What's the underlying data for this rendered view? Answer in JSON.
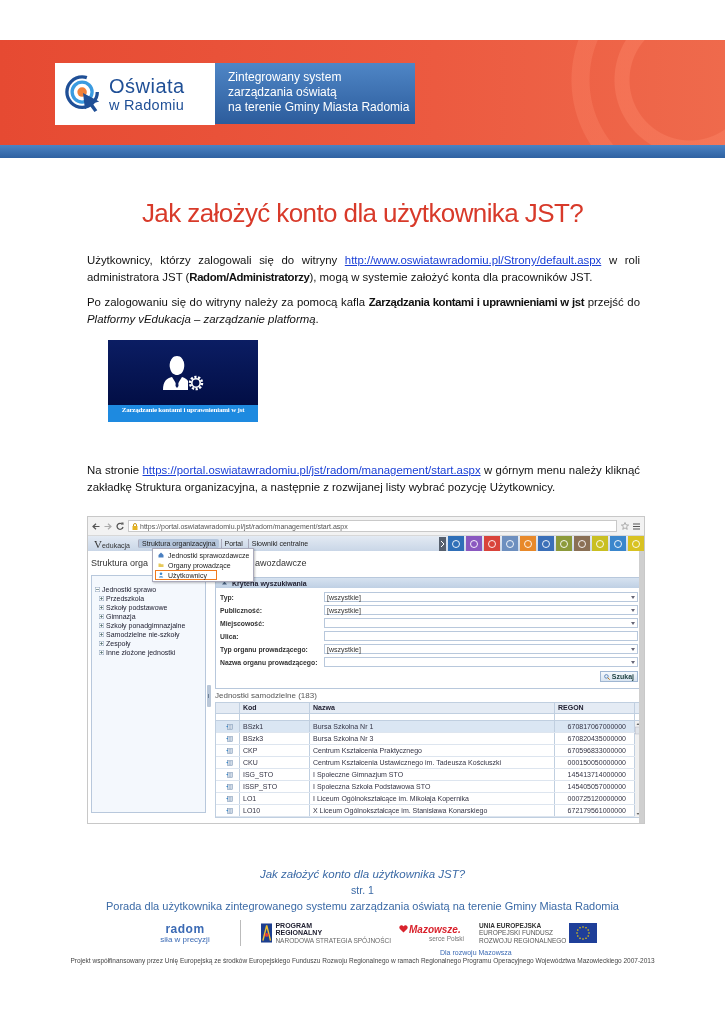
{
  "header": {
    "logo": {
      "line1": "Oświata",
      "line2": "w Radomiu"
    },
    "tagline": [
      "Zintegrowany system",
      "zarządzania oświatą",
      "na terenie Gminy Miasta Radomia"
    ]
  },
  "title": "Jak założyć konto dla użytkownika JST?",
  "paragraphs_top": [
    {
      "parts": [
        {
          "kind": "text",
          "text": "Użytkownicy, którzy zalogowali się do witryny "
        },
        {
          "kind": "link",
          "text": "http://www.oswiatawradomiu.pl/Strony/default.aspx"
        },
        {
          "kind": "text",
          "text": " w roli administratora JST (**Radom/Administratorzy**), mogą w systemie założyć konta dla pracowników JST."
        }
      ]
    },
    {
      "parts": [
        {
          "kind": "text",
          "text": "Po zalogowaniu się do witryny należy za pomocą kafla **Zarządzania kontami i uprawnieniami w jst** przejść do *Platformy vEdukacja – zarządzanie platformą*."
        }
      ]
    }
  ],
  "tile": {
    "label": "Zarządzanie kontami i uprawnieniami w jst"
  },
  "paragraphs_bottom": [
    {
      "parts": [
        {
          "kind": "text",
          "text": "Na stronie "
        },
        {
          "kind": "link",
          "text": "https://portal.oswiatawradomiu.pl/jst/radom/management/start.aspx"
        },
        {
          "kind": "text",
          "text": " w górnym menu należy kliknąć zakładkę Struktura organizacyjna, a następnie z rozwijanej listy wybrać pozycję Użytkownicy."
        }
      ]
    }
  ],
  "screenshot": {
    "browser": {
      "url": "https://portal.oswiatawradomiu.pl/jst/radom/management/start.aspx"
    },
    "app_logo": {
      "mark": "V",
      "text": "edukacja"
    },
    "tabs": [
      {
        "label": "Struktura organizacyjna",
        "selected": true
      },
      {
        "label": "Portal",
        "selected": false
      },
      {
        "label": "Słowniki centralne",
        "selected": false
      }
    ],
    "toolbar_tiles": [
      {
        "color": "#2f6fb8"
      },
      {
        "color": "#8a58c0"
      },
      {
        "color": "#d9433a"
      },
      {
        "color": "#6d8fbf"
      },
      {
        "color": "#e8892a"
      },
      {
        "color": "#3a6fb8"
      },
      {
        "color": "#8c9a3a"
      },
      {
        "color": "#8a7055"
      },
      {
        "color": "#c9bf22"
      },
      {
        "color": "#3a86cc"
      },
      {
        "color": "#d8c222"
      }
    ],
    "page_title": {
      "left": "Struktura orga",
      "right": "awozdawcze"
    },
    "menu": [
      {
        "label": "Jednostki sprawozdawcze",
        "selected": false
      },
      {
        "label": "Organy prowadzące",
        "selected": false
      },
      {
        "label": "Użytkownicy",
        "selected": true
      }
    ],
    "tree": {
      "label": "Jednostki sprawo",
      "expanded": true,
      "children": [
        {
          "label": "Przedszkola",
          "expanded": false
        },
        {
          "label": "Szkoły podstawowe",
          "expanded": false
        },
        {
          "label": "Gimnazja",
          "expanded": false
        },
        {
          "label": "Szkoły ponadgimnazjalne",
          "expanded": false
        },
        {
          "label": "Samodzielne nie-szkoły",
          "expanded": false
        },
        {
          "label": "Zespoły",
          "expanded": false
        },
        {
          "label": "Inne złożone jednostki",
          "expanded": false
        }
      ]
    },
    "criteria": {
      "title": "Kryteria wyszukiwania",
      "fields": [
        {
          "label": "Typ:",
          "kind": "select",
          "value": "[wszystkie]"
        },
        {
          "label": "Publiczność:",
          "kind": "select",
          "value": "[wszystkie]"
        },
        {
          "label": "Miejscowość:",
          "kind": "select"
        },
        {
          "label": "Ulica:",
          "kind": "input"
        },
        {
          "label": "Typ organu prowadzącego:",
          "kind": "select",
          "value": "[wszystkie]"
        },
        {
          "label": "Nazwa organu prowadzącego:",
          "kind": "select"
        }
      ],
      "button": "Szukaj"
    },
    "table": {
      "title": "Jednostki samodzielne (183)",
      "columns": [
        "Kod",
        "Nazwa",
        "REGON"
      ],
      "rows": [
        {
          "cells": [
            "BSzk1",
            "Bursa Szkolna Nr 1",
            "670817067000000"
          ],
          "selected": true
        },
        {
          "cells": [
            "BSzk3",
            "Bursa Szkolna Nr 3",
            "670820435000000"
          ],
          "selected": false
        },
        {
          "cells": [
            "CKP",
            "Centrum Kształcenia Praktycznego",
            "670596833000000"
          ],
          "selected": false
        },
        {
          "cells": [
            "CKU",
            "Centrum Kształcenia Ustawicznego im. Tadeusza Kościuszki",
            "000150050000000"
          ],
          "selected": false
        },
        {
          "cells": [
            "ISG_STO",
            "I Społeczne Gimnazjum STO",
            "145413714000000"
          ],
          "selected": false
        },
        {
          "cells": [
            "ISSP_STO",
            "I Społeczna Szkoła Podstawowa STO",
            "145405057000000"
          ],
          "selected": false
        },
        {
          "cells": [
            "LO1",
            "I Liceum Ogólnokształcące im. Mikołaja Kopernika",
            "000725120000000"
          ],
          "selected": false
        },
        {
          "cells": [
            "LO10",
            "X Liceum Ogólnokształcące im. Stanisława Konarskiego",
            "672179561000000"
          ],
          "selected": false
        }
      ]
    }
  },
  "footer": {
    "doc_title": "Jak założyć konto dla użytkownika JST?",
    "page": "str. 1",
    "subtitle": "Porada dla użytkownika zintegrowanego systemu zarządzania oświatą na terenie Gminy Miasta Radomia",
    "logos": {
      "radom": {
        "name": "radom",
        "slogan": "siła w precyzji"
      },
      "program": {
        "line1": "PROGRAM",
        "line2": "REGIONALNY",
        "line3": "NARODOWA STRATEGIA SPÓJNOŚCI"
      },
      "mazowsze": {
        "name": "Mazowsze.",
        "slogan": "serce Polski"
      },
      "eu": {
        "line1": "UNIA EUROPEJSKA",
        "line2": "EUROPEJSKI FUNDUSZ",
        "line3": "ROZWOJU REGIONALNEGO"
      }
    },
    "motto": "Dla rozwoju Mazowsza",
    "disclaimer": "Projekt współfinansowany przez Unię Europejską ze środków Europejskiego Funduszu Rozwoju Regionalnego w ramach Regionalnego Programu Operacyjnego Województwa Mazowieckiego 2007-2013"
  }
}
